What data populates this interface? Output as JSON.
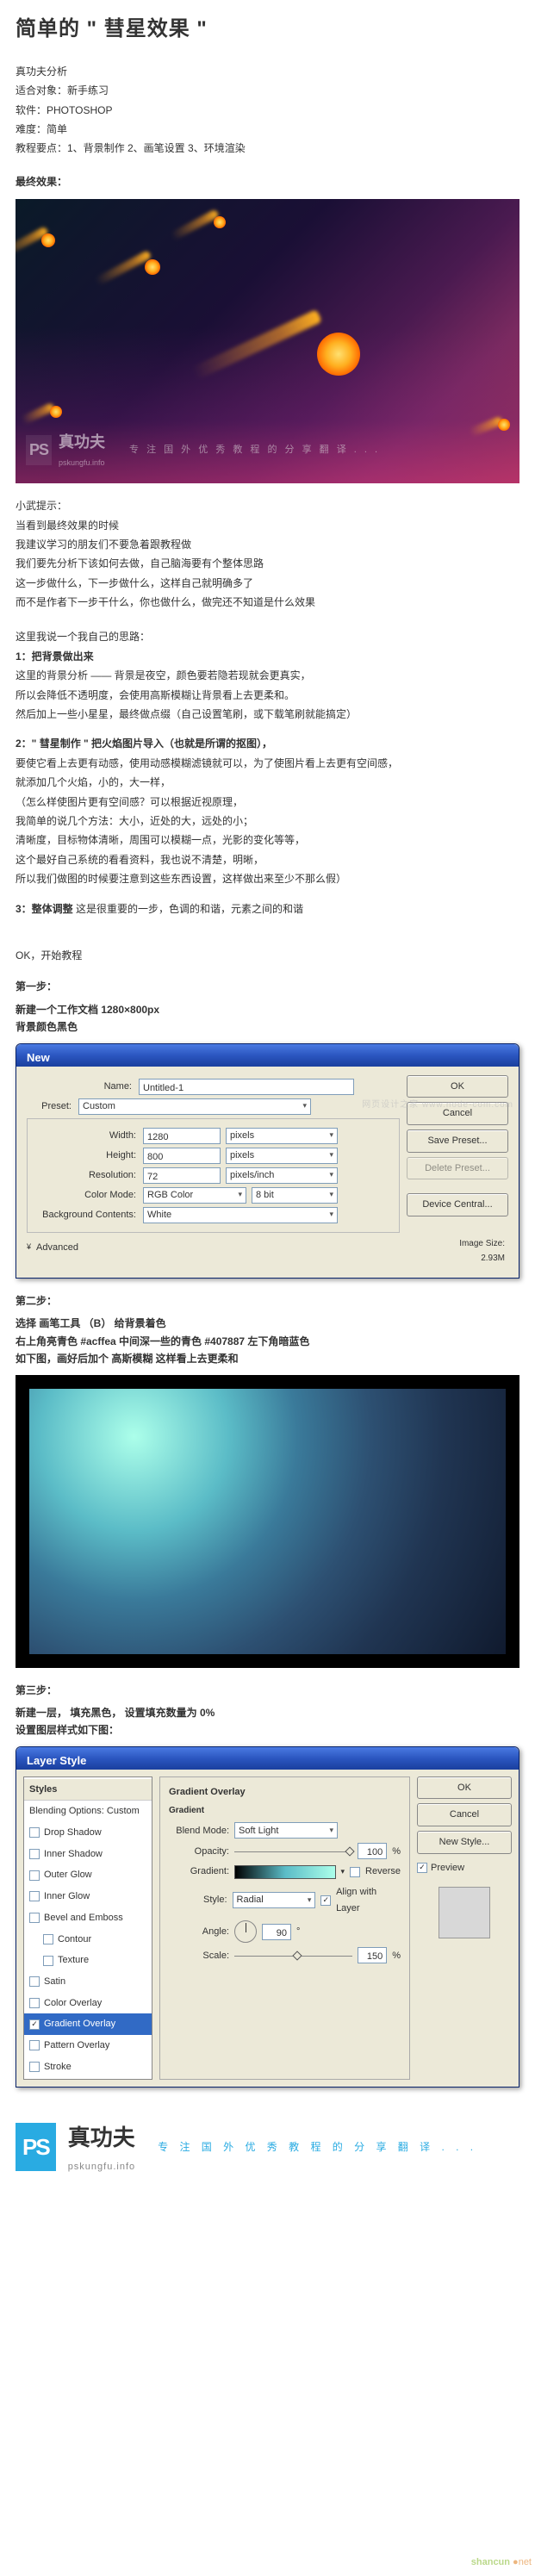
{
  "title": "简单的 \" 彗星效果 \"",
  "meta": {
    "l1": "真功夫分析",
    "l2": "适合对象：新手练习",
    "l3": "软件：PHOTOSHOP",
    "l4": "难度：简单",
    "l5": "教程要点：1、背景制作   2、画笔设置   3、环境渲染"
  },
  "final_label": "最终效果：",
  "wm": {
    "ps": "PS",
    "cn": "真功夫",
    "url": "pskungfu.info",
    "tag": "专 注 国 外 优 秀 教 程 的 分 享 翻 译 . . ."
  },
  "tip": {
    "h": "小武提示：",
    "t1": "当看到最终效果的时候",
    "t2": "我建议学习的朋友们不要急着跟教程做",
    "t3": "我们要先分析下该如何去做，自己脑海要有个整体思路",
    "t4": "这一步做什么，下一步做什么，这样自己就明确多了",
    "t5": "而不是作者下一步干什么，你也做什么，做完还不知道是什么效果"
  },
  "think": {
    "h": "这里我说一个我自己的思路：",
    "s1h": "1：把背景做出来",
    "s1a": "这里的背景分析 —— 背景是夜空，颜色要若隐若现就会更真实，",
    "s1b": "所以会降低不透明度，会使用高斯模糊让背景看上去更柔和。",
    "s1c": "然后加上一些小星星，最终做点缀（自己设置笔刷，或下载笔刷就能搞定）",
    "s2h": "2：\" 彗星制作 \" 把火焰图片导入（也就是所谓的抠图），",
    "s2a": "要使它看上去更有动感，使用动感模糊滤镜就可以，为了使图片看上去更有空间感，",
    "s2b": "就添加几个火焰，小的，大一样，",
    "s2c": "（怎么样使图片更有空间感？可以根据近视原理，",
    "s2d": "我简单的说几个方法：大小，近处的大，远处的小；",
    "s2e": "清晰度，目标物体清晰，周围可以模糊一点，光影的变化等等，",
    "s2f": "这个最好自己系统的看看资料，我也说不清楚，明晰，",
    "s2g": "所以我们做图的时候要注意到这些东西设置，这样做出来至少不那么假）",
    "s3h": "3：整体调整",
    "s3t": "这是很重要的一步，色调的和谐，元素之间的和谐"
  },
  "start": {
    "ok": "OK，开始教程",
    "s1": "第一步：",
    "s1a": "新建一个工作文档 1280×800px",
    "s1b": "背景颜色黑色"
  },
  "dlg_new": {
    "title": "New",
    "name_l": "Name:",
    "name_v": "Untitled-1",
    "preset_l": "Preset:",
    "preset_v": "Custom",
    "width_l": "Width:",
    "width_v": "1280",
    "width_u": "pixels",
    "height_l": "Height:",
    "height_v": "800",
    "height_u": "pixels",
    "res_l": "Resolution:",
    "res_v": "72",
    "res_u": "pixels/inch",
    "mode_l": "Color Mode:",
    "mode_v": "RGB Color",
    "mode_b": "8 bit",
    "bg_l": "Background Contents:",
    "bg_v": "White",
    "adv": "Advanced",
    "size_l": "Image Size:",
    "size_v": "2.93M",
    "btn_ok": "OK",
    "btn_cancel": "Cancel",
    "btn_save": "Save Preset...",
    "btn_del": "Delete Preset...",
    "btn_dev": "Device Central..."
  },
  "step2": {
    "h": "第二步：",
    "a": "选择  画笔工具 （B） 给背景着色",
    "b": "右上角亮青色 #acffea   中间深一些的青色 #407887  左下角暗蓝色",
    "c": "如下图，画好后加个   高斯模糊  这样看上去更柔和"
  },
  "step3": {
    "h": "第三步：",
    "a": "新建一层，  填充黑色， 设置填充数量为 0%",
    "b": "设置图层样式如下图："
  },
  "ls": {
    "title": "Layer Style",
    "items": [
      "Styles",
      "Blending Options: Custom",
      "Drop Shadow",
      "Inner Shadow",
      "Outer Glow",
      "Inner Glow",
      "Bevel and Emboss",
      "Contour",
      "Texture",
      "Satin",
      "Color Overlay",
      "Gradient Overlay",
      "Pattern Overlay",
      "Stroke"
    ],
    "grp_t1": "Gradient Overlay",
    "grp_t2": "Gradient",
    "blend_l": "Blend Mode:",
    "blend_v": "Soft Light",
    "op_l": "Opacity:",
    "op_v": "100",
    "pct": "%",
    "grad_l": "Gradient:",
    "rev": "Reverse",
    "style_l": "Style:",
    "style_v": "Radial",
    "align": "Align with Layer",
    "angle_l": "Angle:",
    "angle_v": "90",
    "scale_l": "Scale:",
    "scale_v": "150",
    "btn_ok": "OK",
    "btn_cancel": "Cancel",
    "btn_new": "New Style...",
    "preview": "Preview"
  },
  "footer": {
    "ps": "PS",
    "main": "真功夫",
    "sub": "pskungfu.info",
    "tag": "专 注 国 外 优 秀 教 程 的 分 享 翻 译 . . ."
  },
  "corner": "shancun",
  "faint_wm": "网页设计之家   www.node-com.com"
}
